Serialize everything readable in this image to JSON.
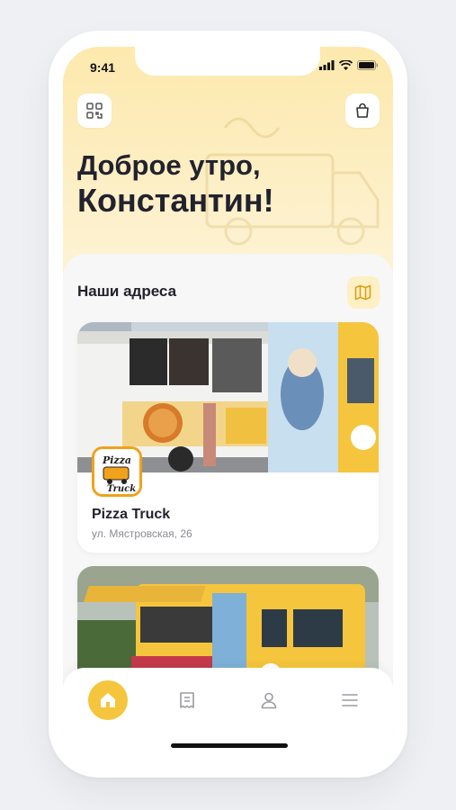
{
  "status_bar": {
    "time": "9:41"
  },
  "header": {
    "greeting_line1": "Доброе утро,",
    "greeting_line2": "Константин!",
    "left_icon": "qr-code-icon",
    "right_icon": "shopping-bag-icon"
  },
  "addresses": {
    "title": "Наши адреса",
    "map_icon": "map-icon",
    "items": [
      {
        "name": "Pizza Truck",
        "address": "ул. Мястровская, 26",
        "logo_text": "Pizza Truck"
      },
      {
        "name": "",
        "address": ""
      }
    ]
  },
  "tabbar": {
    "items": [
      {
        "icon": "home-icon",
        "active": true
      },
      {
        "icon": "receipt-icon",
        "active": false
      },
      {
        "icon": "profile-icon",
        "active": false
      },
      {
        "icon": "menu-icon",
        "active": false
      }
    ]
  },
  "colors": {
    "accent": "#f5c53d",
    "hero": "#fde9ad",
    "text": "#22222e",
    "muted": "#8a8a92"
  }
}
